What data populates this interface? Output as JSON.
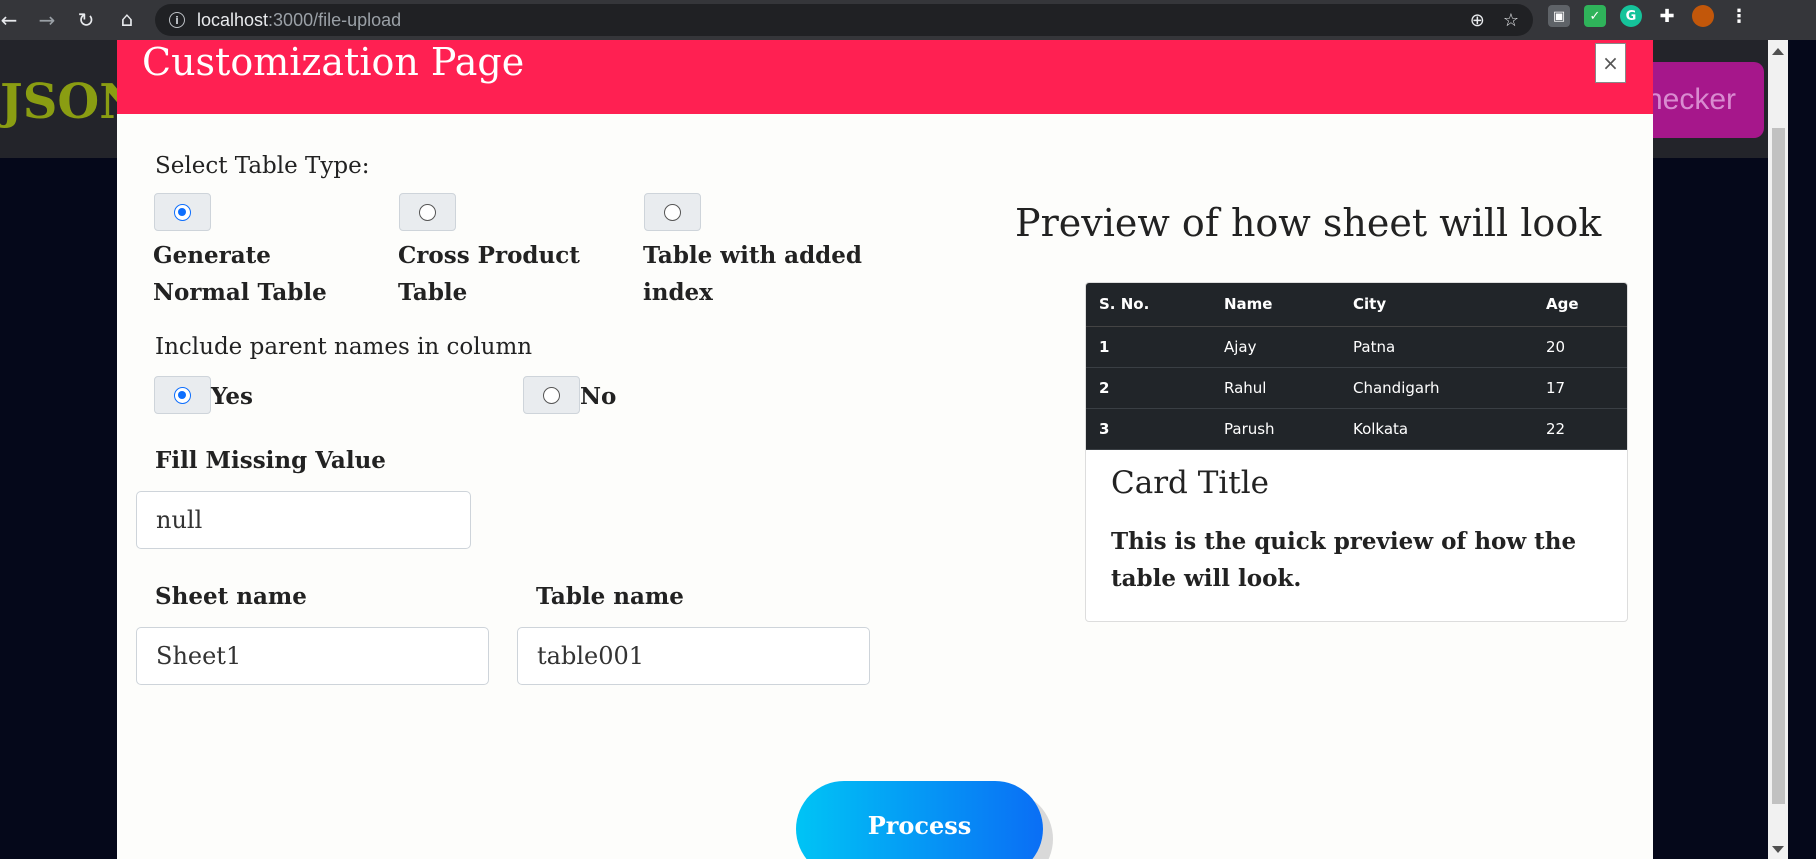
{
  "browser": {
    "url_host": "localhost",
    "url_path": ":3000/file-upload"
  },
  "page": {
    "logo": "JSON",
    "checker_button": "necker"
  },
  "modal": {
    "title": "Customization Page",
    "close_label": "×",
    "table_type_label": "Select Table Type:",
    "table_types": [
      {
        "label": "Generate Normal Table",
        "checked": true
      },
      {
        "label": "Cross Product Table",
        "checked": false
      },
      {
        "label": "Table with added index",
        "checked": false
      }
    ],
    "parent_names_label": "Include parent names in column",
    "parent_options": [
      {
        "label": "Yes",
        "checked": true
      },
      {
        "label": "No",
        "checked": false
      }
    ],
    "fill_missing_label": "Fill Missing Value",
    "fill_missing_value": "null",
    "sheet_name_label": "Sheet name",
    "sheet_name_value": "Sheet1",
    "table_name_label": "Table name",
    "table_name_value": "table001",
    "process_label": "Process"
  },
  "preview": {
    "title": "Preview of how sheet will look",
    "columns": [
      "S. No.",
      "Name",
      "City",
      "Age"
    ],
    "rows": [
      [
        "1",
        "Ajay",
        "Patna",
        "20"
      ],
      [
        "2",
        "Rahul",
        "Chandigarh",
        "17"
      ],
      [
        "3",
        "Parush",
        "Kolkata",
        "22"
      ]
    ],
    "card_title": "Card Title",
    "card_text": "This is the quick preview of how the table will look."
  }
}
